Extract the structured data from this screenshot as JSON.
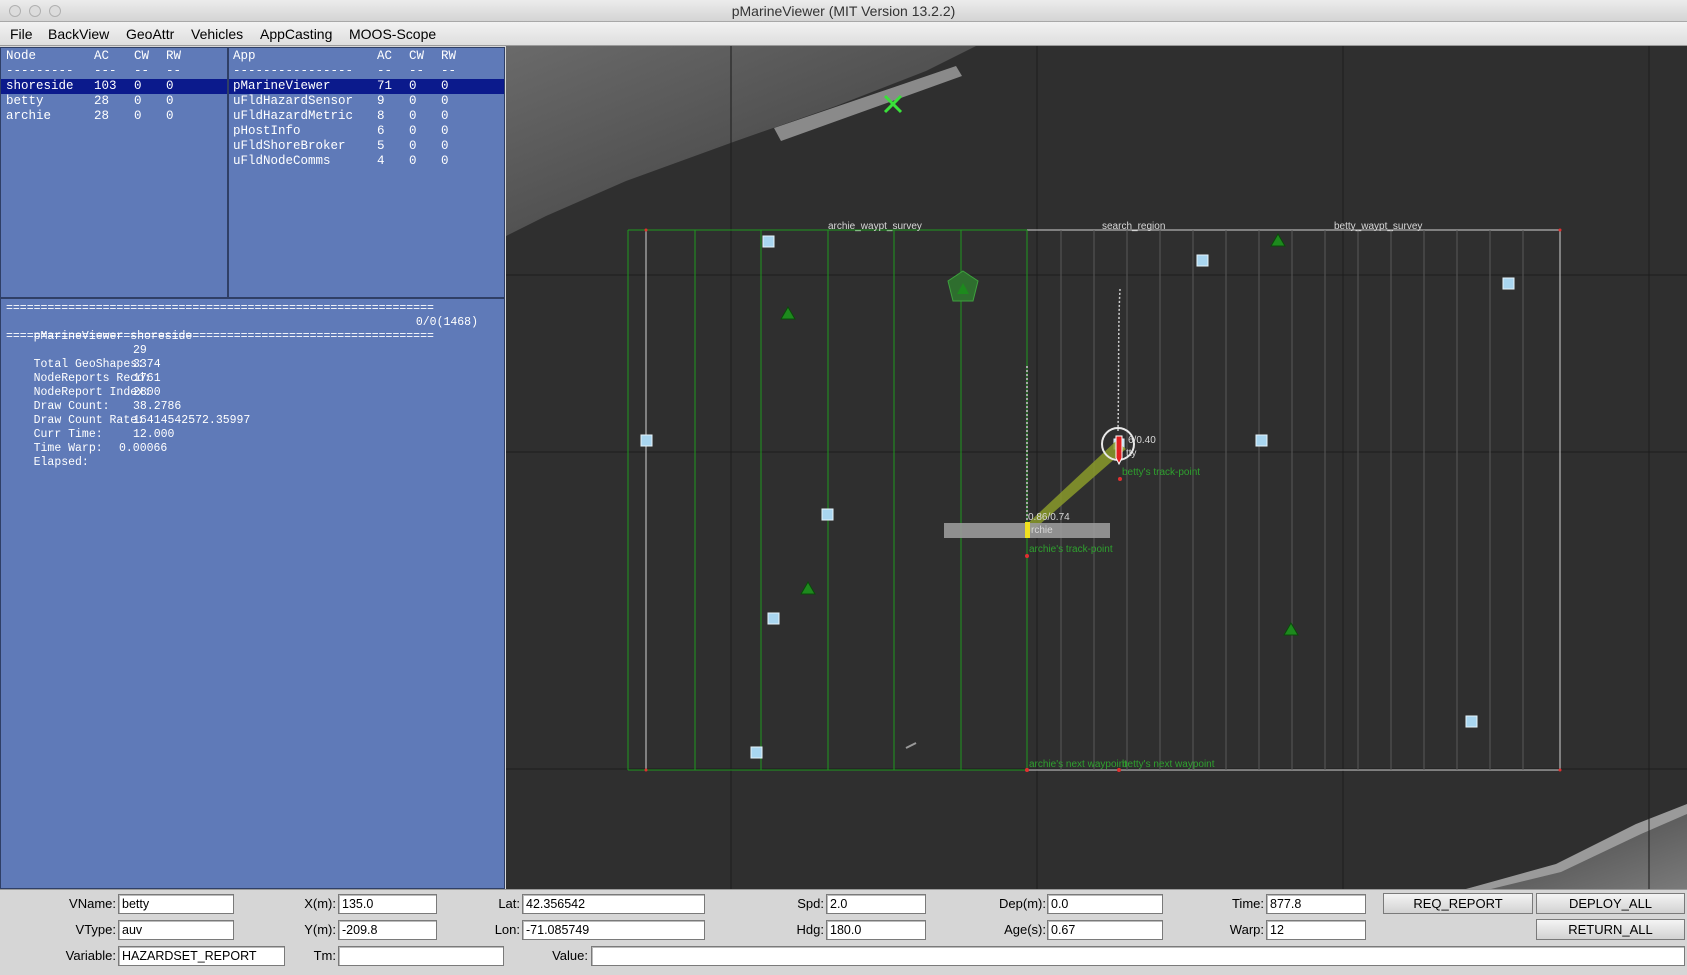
{
  "window": {
    "title": "pMarineViewer (MIT Version 13.2.2)"
  },
  "menu": [
    "File",
    "BackView",
    "GeoAttr",
    "Vehicles",
    "AppCasting",
    "MOOS-Scope"
  ],
  "nodes": {
    "headers": [
      "Node",
      "AC",
      "CW",
      "RW"
    ],
    "separators": [
      "---------",
      "---",
      "--",
      "--"
    ],
    "rows": [
      [
        "shoreside",
        "103",
        "0",
        "0"
      ],
      [
        "betty",
        "28",
        "0",
        "0"
      ],
      [
        "archie",
        "28",
        "0",
        "0"
      ]
    ]
  },
  "apps": {
    "headers": [
      "App",
      "AC",
      "CW",
      "RW"
    ],
    "separators": [
      "----------------",
      "--",
      "--",
      "--"
    ],
    "rows": [
      [
        "pMarineViewer",
        "71",
        "0",
        "0"
      ],
      [
        "uFldHazardSensor",
        "9",
        "0",
        "0"
      ],
      [
        "uFldHazardMetric",
        "8",
        "0",
        "0"
      ],
      [
        "pHostInfo",
        "6",
        "0",
        "0"
      ],
      [
        "uFldShoreBroker",
        "5",
        "0",
        "0"
      ],
      [
        "uFldNodeComms",
        "4",
        "0",
        "0"
      ]
    ]
  },
  "appcast": {
    "rule": "==============================================================",
    "header_left": "pMarineViewer shoreside",
    "header_right": "0/0(1468)",
    "lines": [
      {
        "label": "Total GeoShapes:",
        "value": "29"
      },
      {
        "label": "NodeReports Recd:",
        "value": "3374"
      },
      {
        "label": "NodeReport Index:",
        "value": "1761"
      },
      {
        "label": "Draw Count:",
        "value": "2800"
      },
      {
        "label": "Draw Count Rate:",
        "value": "38.2786"
      },
      {
        "label": "Curr Time:",
        "value": "16414542572.35997"
      },
      {
        "label": "Time Warp:",
        "value": "12.000"
      },
      {
        "label": "Elapsed:",
        "value": "0.00066"
      }
    ]
  },
  "map": {
    "labels": {
      "archie_survey": "archie_waypt_survey",
      "search_region": "search_region",
      "betty_survey": "betty_waypt_survey",
      "betty_value": "6/0.40",
      "betty_name": "tty",
      "betty_track": "betty's track-point",
      "archie_value": "0.86/0.74",
      "archie_name": "rchie",
      "archie_track": "archie's track-point",
      "archie_next": "archie's next waypoint",
      "betty_next": "betty's next waypoint"
    }
  },
  "controls": {
    "vname": {
      "label": "VName:",
      "value": "betty"
    },
    "vtype": {
      "label": "VType:",
      "value": "auv"
    },
    "variable": {
      "label": "Variable:",
      "value": "HAZARDSET_REPORT"
    },
    "x": {
      "label": "X(m):",
      "value": "135.0"
    },
    "y": {
      "label": "Y(m):",
      "value": "-209.8"
    },
    "tm": {
      "label": "Tm:",
      "value": ""
    },
    "lat": {
      "label": "Lat:",
      "value": "42.356542"
    },
    "lon": {
      "label": "Lon:",
      "value": "-71.085749"
    },
    "value": {
      "label": "Value:",
      "value": ""
    },
    "spd": {
      "label": "Spd:",
      "value": "2.0"
    },
    "hdg": {
      "label": "Hdg:",
      "value": "180.0"
    },
    "dep": {
      "label": "Dep(m):",
      "value": "0.0"
    },
    "age": {
      "label": "Age(s):",
      "value": "0.67"
    },
    "time": {
      "label": "Time:",
      "value": "877.8"
    },
    "warp": {
      "label": "Warp:",
      "value": "12"
    },
    "req_report": "REQ_REPORT",
    "deploy_all": "DEPLOY_ALL",
    "return_all": "RETURN_ALL"
  },
  "colors": {
    "panel_bg": "#5f7ab8",
    "selection": "#0b1a8c",
    "survey_line": "#1f9a1f",
    "hazard_box": "#a9d6f0",
    "hazard_triangle": "#1d8a1d"
  }
}
